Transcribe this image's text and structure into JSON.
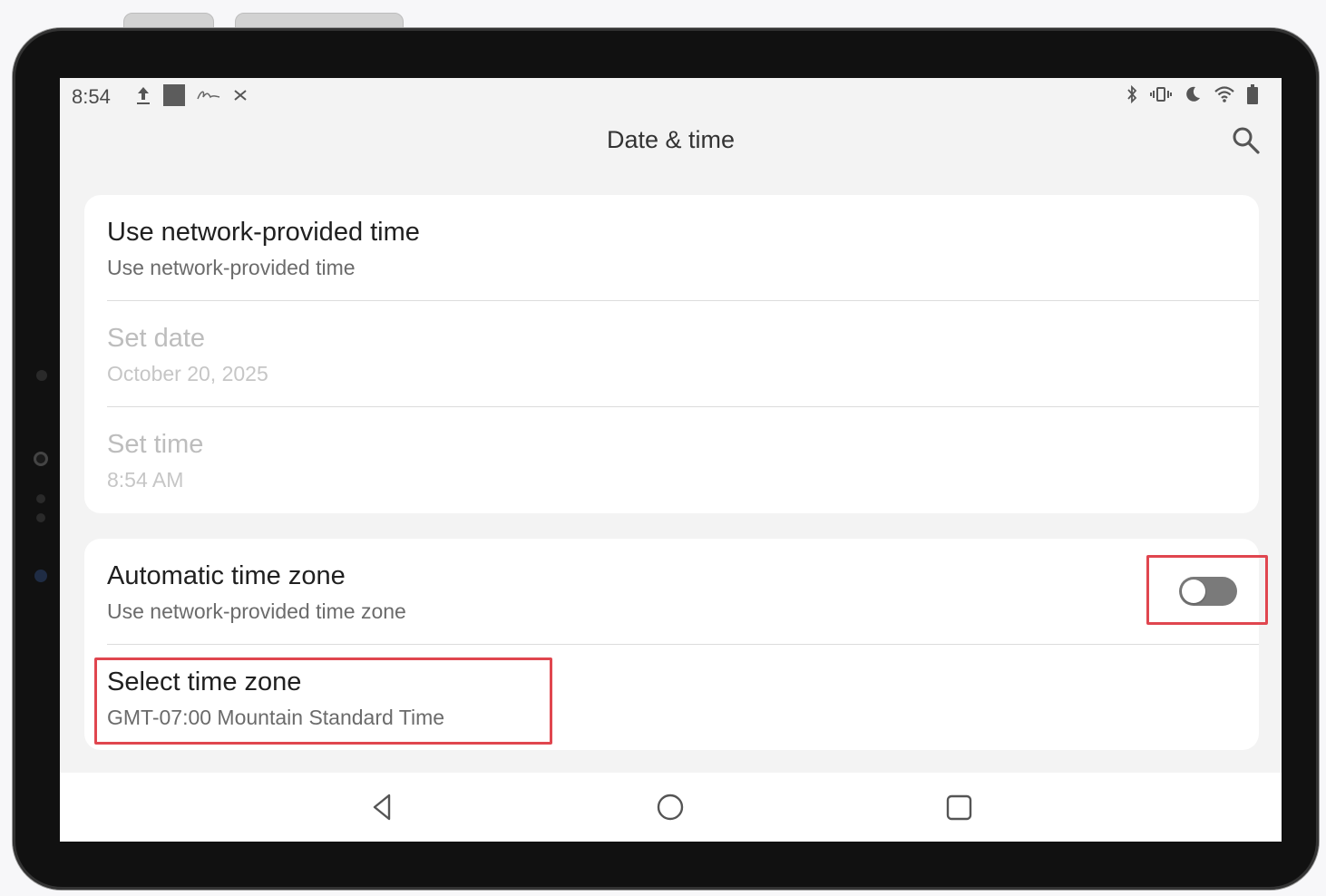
{
  "status_bar": {
    "time": "8:54",
    "left_icons": [
      "upload-icon",
      "media-square-icon",
      "signature-icon",
      "connection-icon"
    ],
    "right_icons": [
      "bluetooth-icon",
      "vibrate-icon",
      "moon-icon",
      "wifi-icon",
      "battery-icon"
    ]
  },
  "app_bar": {
    "title": "Date & time",
    "search_icon": "search-icon"
  },
  "time_card": {
    "rows": [
      {
        "title": "Use network-provided time",
        "subtitle": "Use network-provided time",
        "enabled": true
      },
      {
        "title": "Set date",
        "subtitle": "October 20, 2025",
        "enabled": false
      },
      {
        "title": "Set time",
        "subtitle": "8:54 AM",
        "enabled": false
      }
    ]
  },
  "zone_card": {
    "auto_zone": {
      "title": "Automatic time zone",
      "subtitle": "Use network-provided time zone",
      "toggle_on": false
    },
    "select_zone": {
      "title": "Select time zone",
      "subtitle": "GMT-07:00 Mountain Standard Time"
    }
  },
  "nav_bar": {
    "back_icon": "back-triangle-icon",
    "home_icon": "home-circle-icon",
    "recents_icon": "recents-square-icon"
  },
  "colors": {
    "highlight": "#e0464f",
    "toggle_off": "#7a7a7a",
    "screen_bg": "#f3f3f3"
  }
}
